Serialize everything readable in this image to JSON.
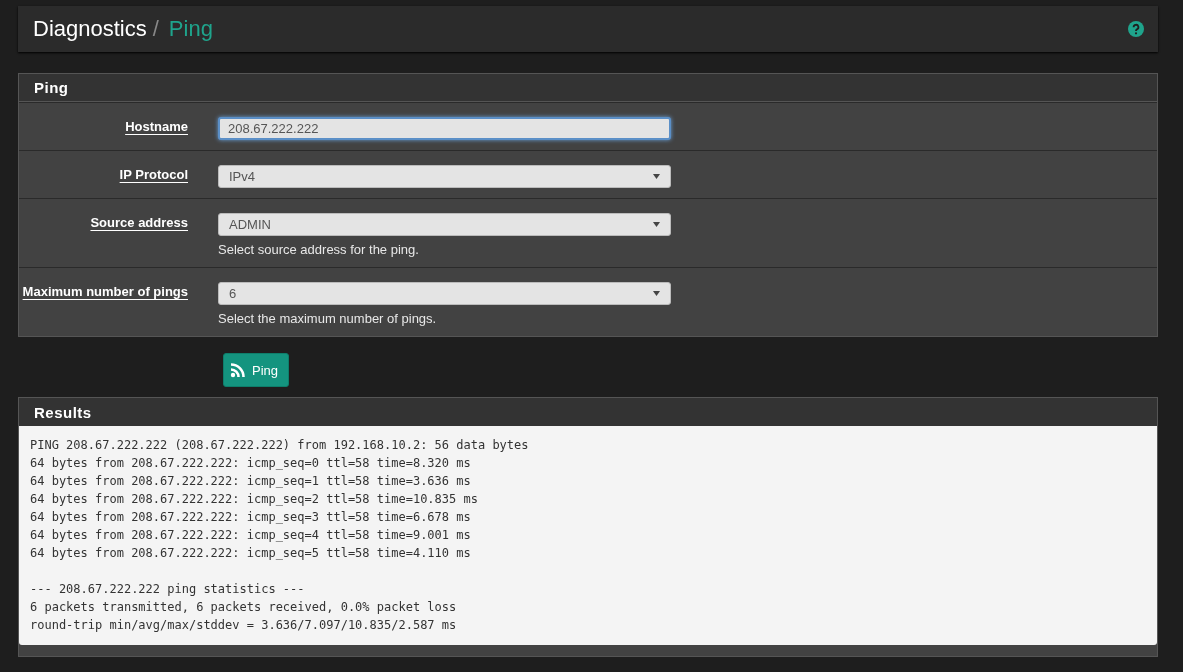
{
  "breadcrumb": {
    "section": "Diagnostics",
    "separator": "/",
    "page": "Ping"
  },
  "form": {
    "title": "Ping",
    "fields": [
      {
        "kind": "input",
        "label": "Hostname",
        "value": "208.67.222.222",
        "focused": true
      },
      {
        "kind": "select",
        "label": "IP Protocol",
        "value": "IPv4",
        "focused": false
      },
      {
        "kind": "select",
        "label": "Source address",
        "value": "ADMIN",
        "help": "Select source address for the ping.",
        "focused": false
      },
      {
        "kind": "select",
        "label": "Maximum number of pings",
        "value": "6",
        "help": "Select the maximum number of pings.",
        "focused": false
      }
    ],
    "button": "Ping"
  },
  "results": {
    "title": "Results",
    "output": "PING 208.67.222.222 (208.67.222.222) from 192.168.10.2: 56 data bytes\n64 bytes from 208.67.222.222: icmp_seq=0 ttl=58 time=8.320 ms\n64 bytes from 208.67.222.222: icmp_seq=1 ttl=58 time=3.636 ms\n64 bytes from 208.67.222.222: icmp_seq=2 ttl=58 time=10.835 ms\n64 bytes from 208.67.222.222: icmp_seq=3 ttl=58 time=6.678 ms\n64 bytes from 208.67.222.222: icmp_seq=4 ttl=58 time=9.001 ms\n64 bytes from 208.67.222.222: icmp_seq=5 ttl=58 time=4.110 ms\n\n--- 208.67.222.222 ping statistics ---\n6 packets transmitted, 6 packets received, 0.0% packet loss\nround-trip min/avg/max/stddev = 3.636/7.097/10.835/2.587 ms"
  }
}
